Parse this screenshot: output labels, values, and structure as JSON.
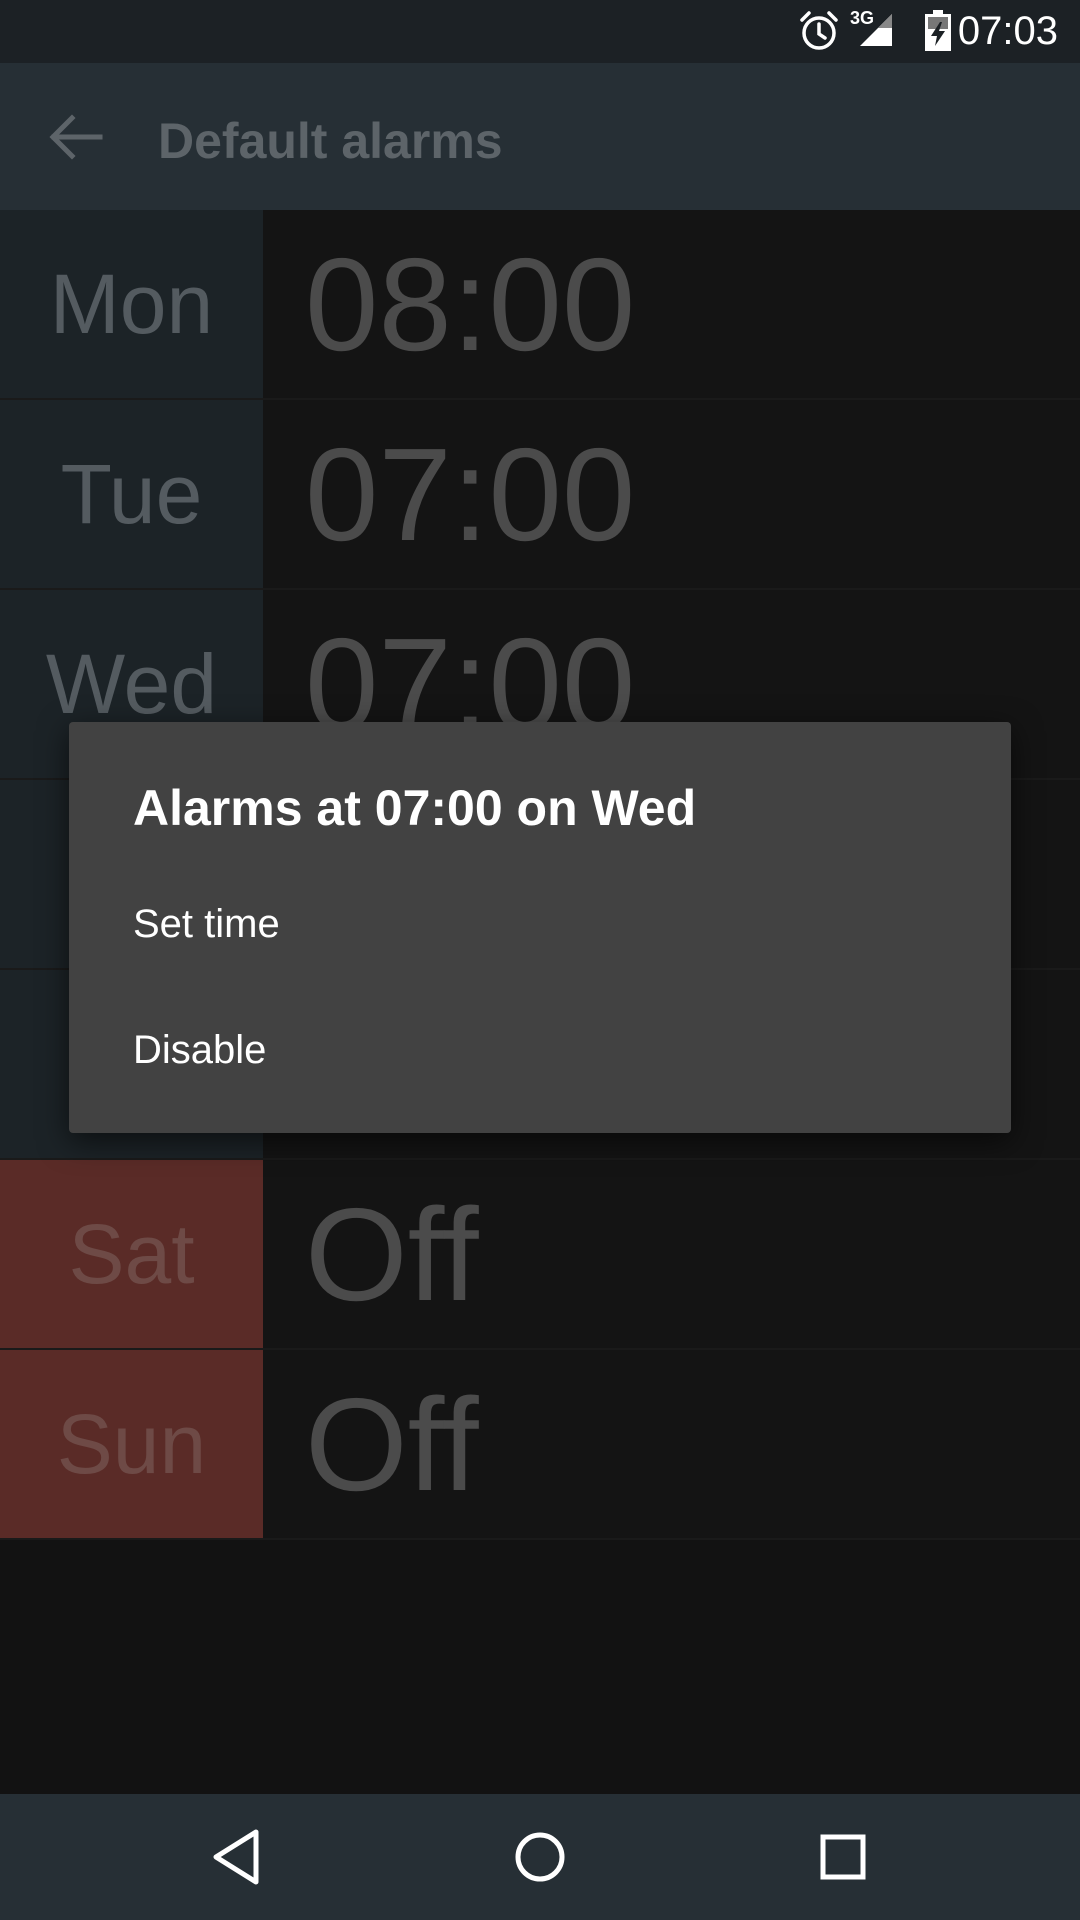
{
  "status_bar": {
    "time": "07:03",
    "network": "3G",
    "icons": [
      "alarm-icon",
      "signal-3g-icon",
      "battery-charging-icon"
    ]
  },
  "app_bar": {
    "title": "Default alarms",
    "back_icon": "arrow-back-icon"
  },
  "days": [
    {
      "day": "Mon",
      "time": "08:00",
      "enabled": true
    },
    {
      "day": "Tue",
      "time": "07:00",
      "enabled": true
    },
    {
      "day": "Wed",
      "time": "07:00",
      "enabled": true
    },
    {
      "day": "",
      "time": "",
      "enabled": true
    },
    {
      "day": "",
      "time": "",
      "enabled": true
    },
    {
      "day": "Sat",
      "time": "Off",
      "enabled": false
    },
    {
      "day": "Sun",
      "time": "Off",
      "enabled": false
    }
  ],
  "dialog": {
    "title": "Alarms at 07:00 on Wed",
    "items": [
      "Set time",
      "Disable"
    ]
  },
  "nav_bar": {
    "icons": [
      "nav-back-icon",
      "nav-home-icon",
      "nav-recents-icon"
    ]
  },
  "colors": {
    "status_bar": "#1c2125",
    "app_bar": "#262f35",
    "day_cell": "#1c2327",
    "day_cell_off": "#5a2b27",
    "dialog": "#424242"
  }
}
